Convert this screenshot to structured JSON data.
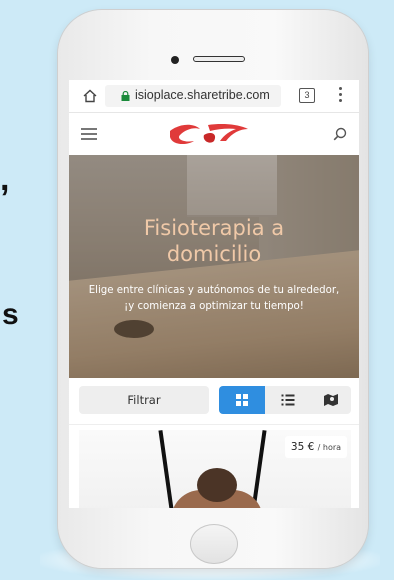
{
  "background_text": {
    "comma": ",",
    "letter": "s"
  },
  "browser": {
    "url": "isioplace.sharetribe.com",
    "tab_count": "3"
  },
  "hero": {
    "title_line1": "Fisioterapia a",
    "title_line2": "domicilio",
    "subtitle_line1": "Elige entre clínicas y autónomos de tu alrededor,",
    "subtitle_line2": "¡y comienza a optimizar tu tiempo!"
  },
  "filters": {
    "filter_label": "Filtrar"
  },
  "listing": {
    "price": "35 €",
    "price_unit": "/ hora"
  },
  "colors": {
    "accent": "#2f8ee0",
    "hero_title": "#f0c9a8",
    "logo": "#e03a3a"
  }
}
